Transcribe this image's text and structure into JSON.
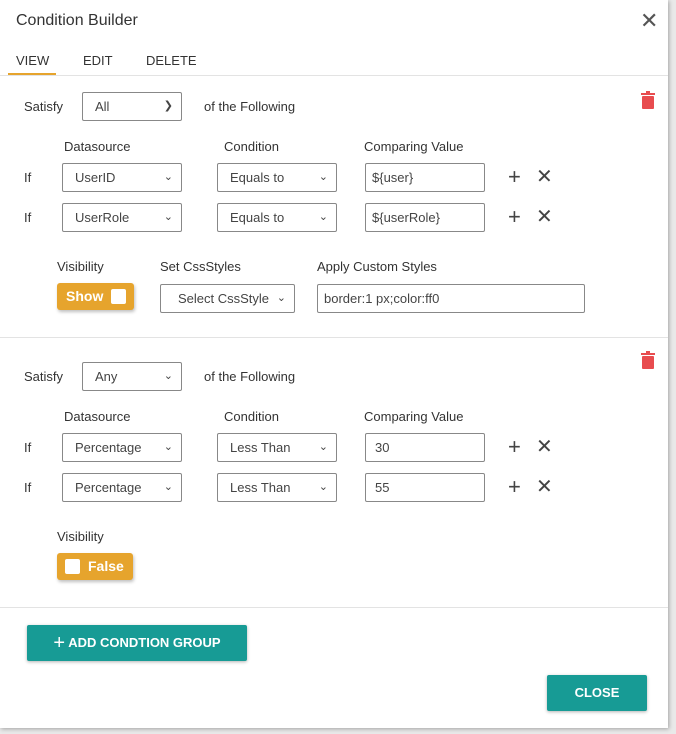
{
  "dialog": {
    "title": "Condition Builder",
    "tabs": [
      "VIEW",
      "EDIT",
      "DELETE"
    ],
    "active_tab": "VIEW"
  },
  "labels": {
    "satisfy": "Satisfy",
    "of_following": "of the Following",
    "datasource": "Datasource",
    "condition": "Condition",
    "comparing_value": "Comparing Value",
    "if": "If",
    "visibility": "Visibility",
    "set_css": "Set CssStyles",
    "apply_custom": "Apply Custom Styles"
  },
  "groups": [
    {
      "satisfy": "All",
      "rows": [
        {
          "datasource": "UserID",
          "condition": "Equals to",
          "value": "${user}"
        },
        {
          "datasource": "UserRole",
          "condition": "Equals to",
          "value": "${userRole}"
        }
      ],
      "visibility": "Show",
      "css_style": "Select CssStyle",
      "custom_styles": "border:1 px;color:ff0"
    },
    {
      "satisfy": "Any",
      "rows": [
        {
          "datasource": "Percentage",
          "condition": "Less Than",
          "value": "30"
        },
        {
          "datasource": "Percentage",
          "condition": "Less Than",
          "value": "55"
        }
      ],
      "visibility": "False"
    }
  ],
  "buttons": {
    "add_group": "ADD CONDTION GROUP",
    "close": "CLOSE"
  },
  "colors": {
    "accent": "#e6a42d",
    "primary": "#179b95",
    "danger": "#e84c4f"
  }
}
